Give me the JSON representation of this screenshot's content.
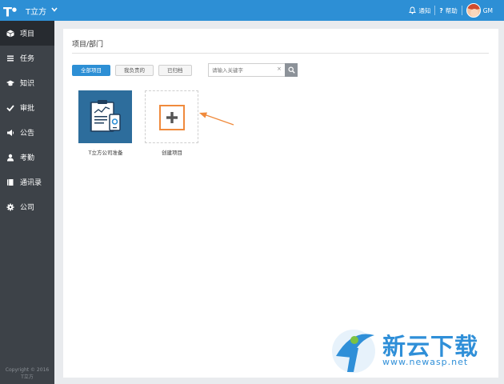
{
  "header": {
    "logo": "T",
    "app_title": "T立方",
    "notify_label": "通知",
    "help_label": "帮助",
    "user_name": "GM"
  },
  "sidebar": {
    "items": [
      {
        "label": "项目",
        "icon": "cube-icon"
      },
      {
        "label": "任务",
        "icon": "list-icon"
      },
      {
        "label": "知识",
        "icon": "graduation-cap-icon"
      },
      {
        "label": "审批",
        "icon": "check-icon"
      },
      {
        "label": "公告",
        "icon": "megaphone-icon"
      },
      {
        "label": "考勤",
        "icon": "user-icon"
      },
      {
        "label": "通讯录",
        "icon": "book-icon"
      },
      {
        "label": "公司",
        "icon": "gear-icon"
      }
    ],
    "copyright_line1": "Copyright © 2016",
    "copyright_line2": "T立方"
  },
  "main": {
    "title": "项目/部门",
    "filters": [
      "全部项目",
      "我负责的",
      "已归档"
    ],
    "search": {
      "placeholder": "请输入关键字",
      "value": ""
    },
    "projects": [
      {
        "name": "T立方公司准备"
      }
    ],
    "create_label": "创建项目"
  },
  "watermark": {
    "text": "新云下载",
    "url": "www.newasp.net"
  },
  "colors": {
    "topbar": "#2d8fd5",
    "sidebar": "#3d4248",
    "accent_orange": "#f08a3c"
  }
}
